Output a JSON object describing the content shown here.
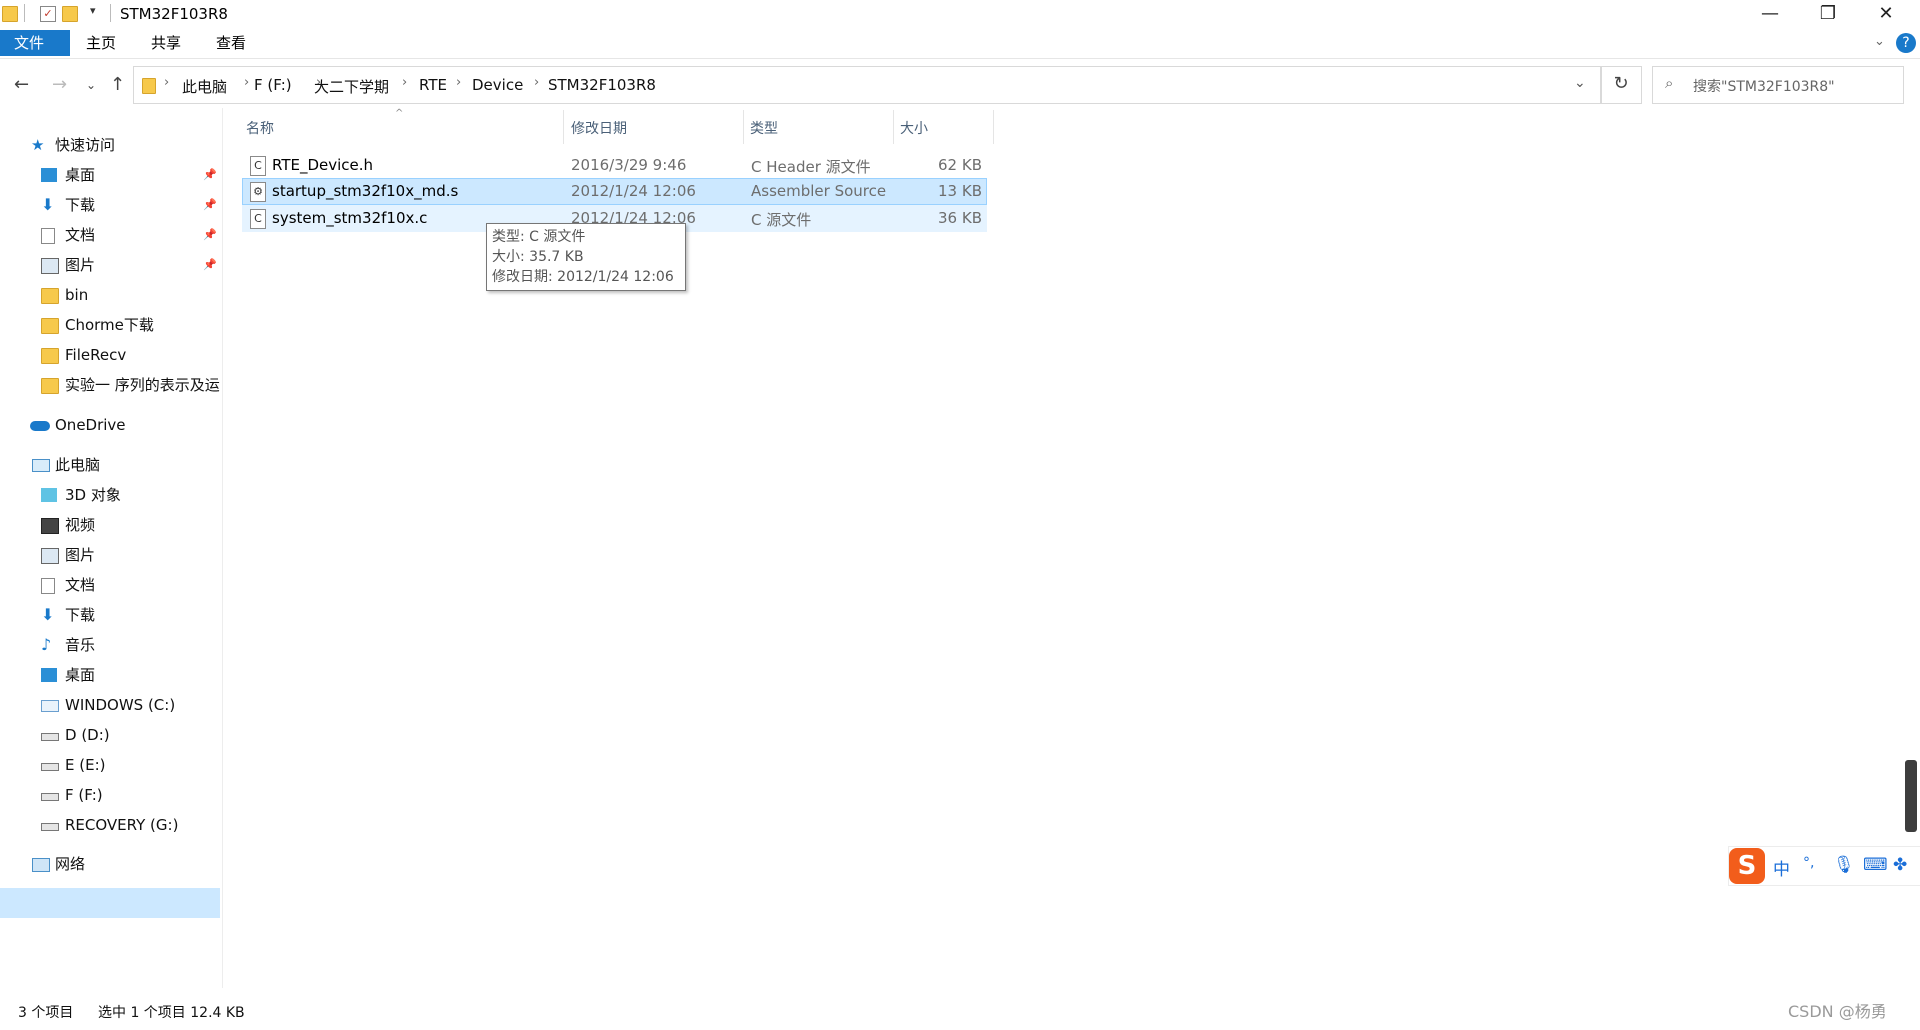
{
  "window": {
    "title": "STM32F103R8",
    "minimize_glyph": "—",
    "maximize_glyph": "❐",
    "close_glyph": "✕"
  },
  "ribbon": {
    "tabs": [
      "文件",
      "主页",
      "共享",
      "查看"
    ],
    "help_glyph": "?"
  },
  "address": {
    "crumbs": [
      "此电脑",
      "F (F:)",
      "大二下学期",
      "RTE",
      "Device",
      "STM32F103R8"
    ],
    "search_placeholder": "搜索\"STM32F103R8\""
  },
  "nav": {
    "quick_access": "快速访问",
    "quick_items": [
      "桌面",
      "下载",
      "文档",
      "图片",
      "bin",
      "Chorme下载",
      "FileRecv",
      "实验一 序列的表示及运"
    ],
    "onedrive": "OneDrive",
    "this_pc": "此电脑",
    "pc_items": [
      "3D 对象",
      "视频",
      "图片",
      "文档",
      "下载",
      "音乐",
      "桌面",
      "WINDOWS (C:)",
      "D (D:)",
      "E (E:)",
      "F (F:)",
      "RECOVERY (G:)"
    ],
    "network": "网络"
  },
  "columns": {
    "name": "名称",
    "modified": "修改日期",
    "type": "类型",
    "size": "大小"
  },
  "files": [
    {
      "name": "RTE_Device.h",
      "modified": "2016/3/29 9:46",
      "type": "C Header 源文件",
      "size": "62 KB",
      "icon": "c-header-file-icon"
    },
    {
      "name": "startup_stm32f10x_md.s",
      "modified": "2012/1/24 12:06",
      "type": "Assembler Source",
      "size": "13 KB",
      "icon": "assembler-file-icon"
    },
    {
      "name": "system_stm32f10x.c",
      "modified": "2012/1/24 12:06",
      "type": "C 源文件",
      "size": "36 KB",
      "icon": "c-source-file-icon"
    }
  ],
  "tooltip": {
    "type": "类型: C 源文件",
    "size": "大小: 35.7 KB",
    "modified": "修改日期: 2012/1/24 12:06"
  },
  "status": {
    "count": "3 个项目",
    "selection": "选中 1 个项目  12.4 KB"
  },
  "ime": {
    "logo": "S",
    "lang": "中",
    "punct": "°,"
  },
  "watermark": "CSDN @杨勇"
}
